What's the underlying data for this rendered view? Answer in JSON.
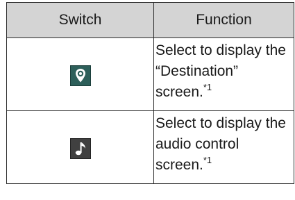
{
  "table": {
    "headers": {
      "switch": "Switch",
      "function": "Function"
    },
    "rows": [
      {
        "icon": "destination-pin-icon",
        "icon_color": "#2d5f5a",
        "function_lines": [
          "Select to display the",
          "“Destination”",
          "screen."
        ],
        "footnote": "*1"
      },
      {
        "icon": "audio-note-icon",
        "icon_color": "#404040",
        "function_lines": [
          "Select to display the",
          "audio control",
          "screen."
        ],
        "footnote": "*1"
      }
    ]
  }
}
